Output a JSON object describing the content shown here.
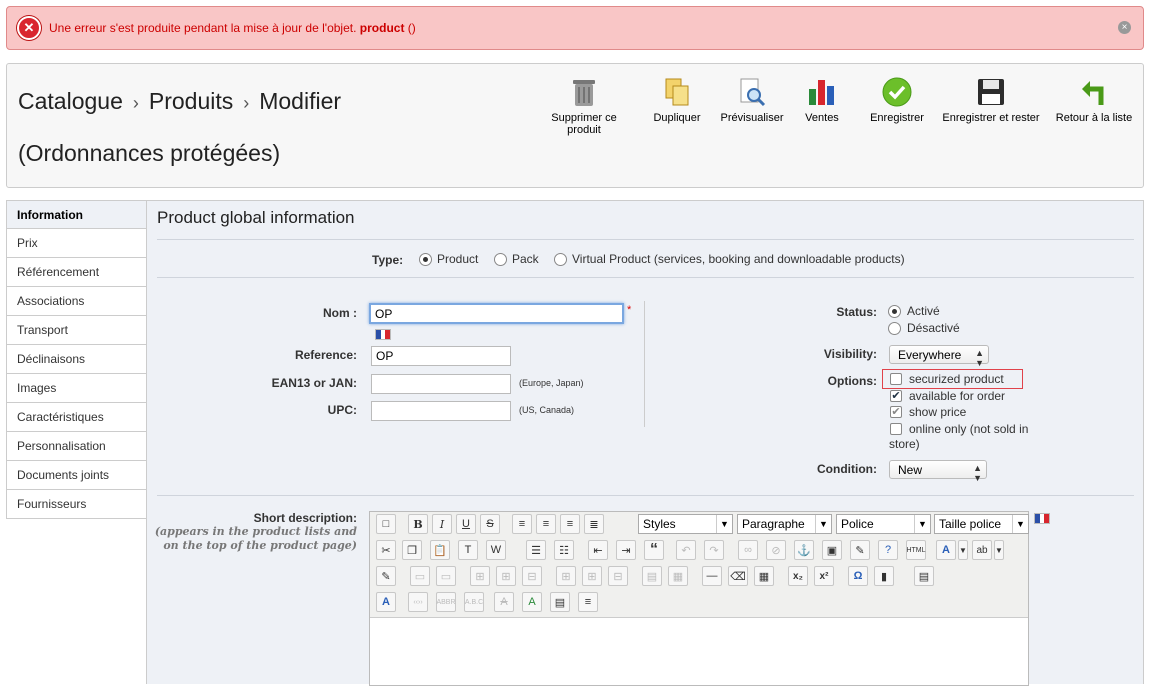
{
  "error": {
    "message": "Une erreur s'est produite pendant la mise à jour de l'objet.",
    "object": "product",
    "suffix": "()",
    "colors": {
      "bg": "#f9c6c6",
      "text": "#cc0000"
    }
  },
  "breadcrumb": {
    "level1": "Catalogue",
    "level2": "Produits",
    "level3": "Modifier",
    "subtitle": "(Ordonnances protégées)"
  },
  "toolbar": [
    {
      "label": "Supprimer ce produit",
      "icon": "trash-icon"
    },
    {
      "label": "Dupliquer",
      "icon": "duplicate-icon"
    },
    {
      "label": "Prévisualiser",
      "icon": "preview-icon"
    },
    {
      "label": "Ventes",
      "icon": "sales-chart-icon"
    },
    {
      "label": "Enregistrer",
      "icon": "save-check-icon"
    },
    {
      "label": "Enregistrer et rester",
      "icon": "floppy-disk-icon"
    },
    {
      "label": "Retour à la liste",
      "icon": "back-arrow-icon"
    }
  ],
  "sidebar": {
    "items": [
      {
        "label": "Information",
        "active": true
      },
      {
        "label": "Prix"
      },
      {
        "label": "Référencement"
      },
      {
        "label": "Associations"
      },
      {
        "label": "Transport"
      },
      {
        "label": "Déclinaisons"
      },
      {
        "label": "Images"
      },
      {
        "label": "Caractéristiques"
      },
      {
        "label": "Personnalisation"
      },
      {
        "label": "Documents joints"
      },
      {
        "label": "Fournisseurs"
      }
    ]
  },
  "form": {
    "title": "Product global information",
    "type_label": "Type:",
    "type_options": [
      "Product",
      "Pack",
      "Virtual Product (services, booking and downloadable products)"
    ],
    "type_selected": "Product",
    "name_label": "Nom :",
    "name_value": "OP",
    "required_mark": "*",
    "reference_label": "Reference:",
    "reference_value": "OP",
    "ean_label": "EAN13 or JAN:",
    "ean_value": "",
    "ean_hint": "(Europe, Japan)",
    "upc_label": "UPC:",
    "upc_value": "",
    "upc_hint": "(US, Canada)",
    "status_label": "Status:",
    "status_options": [
      "Activé",
      "Désactivé"
    ],
    "status_selected": "Activé",
    "visibility_label": "Visibility:",
    "visibility_value": "Everywhere",
    "options_label": "Options:",
    "options": [
      {
        "label": "securized product",
        "checked": false
      },
      {
        "label": "available for order",
        "checked": true
      },
      {
        "label": "show price",
        "checked": true
      },
      {
        "label": "online only (not sold in store)",
        "checked": false
      }
    ],
    "condition_label": "Condition:",
    "condition_value": "New",
    "short_desc_label": "Short description:",
    "short_desc_hint": "(appears in the product lists and on the top of the product page)"
  },
  "editor": {
    "selects": [
      "Styles",
      "Paragraphe",
      "Police",
      "Taille police"
    ]
  }
}
